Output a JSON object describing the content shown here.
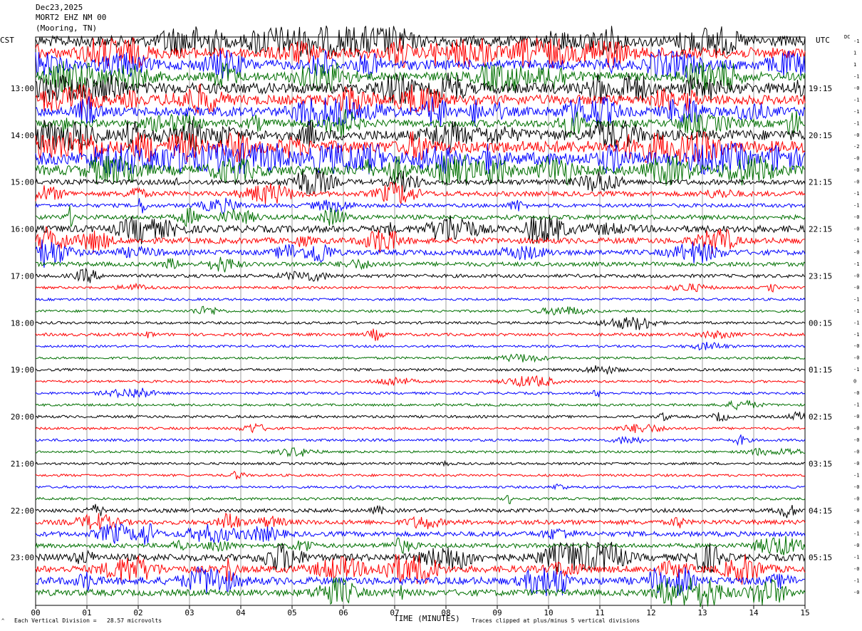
{
  "header": {
    "date": "Dec23,2025",
    "station": "MORT2 EHZ NM 00",
    "location": "(Mooring, TN)"
  },
  "labels": {
    "left_timezone": "CST",
    "right_timezone": "UTC",
    "dc_column": "DC",
    "corner_mark": "^"
  },
  "footer": {
    "scale": "Each Vertical Division =   28.57 microvolts",
    "clip_note": "Traces clipped at plus/minus 5 vertical divisions"
  },
  "chart_data": {
    "type": "helicorder",
    "xlabel": "TIME (MINUTES)",
    "xlim": [
      0,
      15
    ],
    "x_ticks": [
      "00",
      "01",
      "02",
      "03",
      "04",
      "05",
      "06",
      "07",
      "08",
      "09",
      "10",
      "11",
      "12",
      "13",
      "14",
      "15"
    ],
    "trace_colors": [
      "#000000",
      "#ff0000",
      "#0000ff",
      "#007000"
    ],
    "grid_color": "#888888",
    "traces_per_hour": 4,
    "left_hour_labels": [
      "13:00",
      "14:00",
      "15:00",
      "16:00",
      "17:00",
      "18:00",
      "19:00",
      "20:00",
      "21:00",
      "22:00",
      "23:00"
    ],
    "right_hour_labels": [
      "19:15",
      "20:15",
      "21:15",
      "22:15",
      "23:15",
      "00:15",
      "01:15",
      "02:15",
      "03:15",
      "04:15",
      "05:15"
    ],
    "dc_offsets": [
      "-1",
      "1",
      "1",
      "-1",
      "-0",
      "-1",
      "-1",
      "-1",
      "-0",
      "-2",
      "-0",
      "-0",
      "-0",
      "-1",
      "-1",
      "-0",
      "-0",
      "-1",
      "-0",
      "-1",
      "-0",
      "-0",
      "-1",
      "-1",
      "-1",
      "-1",
      "-0",
      "-0",
      "-1",
      "0",
      "-0",
      "-1",
      "-0",
      "-0",
      "-0",
      "-0",
      "-0",
      "-1",
      "-0",
      "-0",
      "-0",
      "-0",
      "-1",
      "-0",
      "-1",
      "-0",
      "-1",
      "-0"
    ],
    "activity": [
      1.6,
      1.6,
      1.4,
      1.2,
      1.6,
      1.4,
      1.3,
      1.0,
      1.5,
      1.8,
      1.9,
      1.4,
      0.6,
      0.55,
      0.35,
      0.5,
      0.9,
      0.7,
      0.6,
      0.45,
      0.3,
      0.12,
      0.12,
      0.12,
      0.15,
      0.2,
      0.1,
      0.1,
      0.15,
      0.12,
      0.12,
      0.12,
      0.15,
      0.12,
      0.15,
      0.1,
      0.12,
      0.12,
      0.12,
      0.15,
      0.35,
      0.5,
      0.55,
      0.45,
      0.9,
      0.9,
      1.0,
      0.8
    ]
  }
}
